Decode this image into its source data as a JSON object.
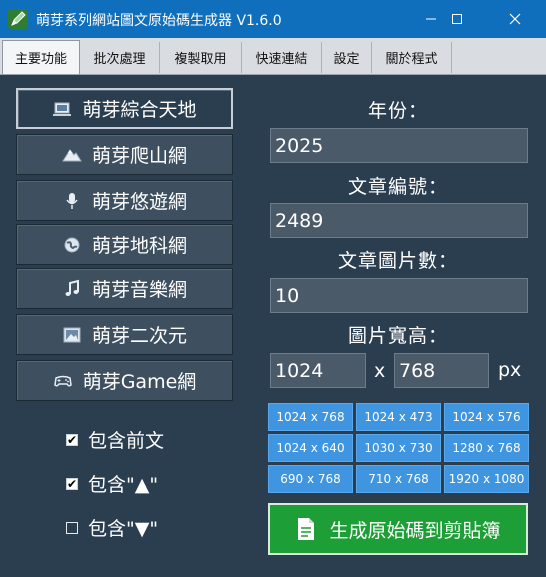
{
  "window": {
    "title": "萌芽系列網站圖文原始碼生成器 V1.6.0"
  },
  "tabs": [
    {
      "label": "主要功能",
      "active": true
    },
    {
      "label": "批次處理",
      "active": false
    },
    {
      "label": "複製取用",
      "active": false
    },
    {
      "label": "快速連結",
      "active": false
    },
    {
      "label": "設定",
      "active": false
    },
    {
      "label": "關於程式",
      "active": false
    }
  ],
  "sites": [
    {
      "label": "萌芽綜合天地",
      "icon": "laptop-icon",
      "active": true
    },
    {
      "label": "萌芽爬山網",
      "icon": "mountain-icon",
      "active": false
    },
    {
      "label": "萌芽悠遊網",
      "icon": "microphone-icon",
      "active": false
    },
    {
      "label": "萌芽地科網",
      "icon": "globe-icon",
      "active": false
    },
    {
      "label": "萌芽音樂網",
      "icon": "music-note-icon",
      "active": false
    },
    {
      "label": "萌芽二次元",
      "icon": "picture-frame-icon",
      "active": false
    },
    {
      "label": "萌芽Game網",
      "icon": "gamepad-icon",
      "active": false
    }
  ],
  "options": [
    {
      "label": "包含前文",
      "checked": true
    },
    {
      "label": "包含\"▲\"",
      "checked": true
    },
    {
      "label": "包含\"▼\"",
      "checked": false
    }
  ],
  "form": {
    "year_label": "年份：",
    "year_value": "2025",
    "article_label": "文章編號：",
    "article_value": "2489",
    "image_count_label": "文章圖片數：",
    "image_count_value": "10",
    "size_label": "圖片寬高：",
    "width_value": "1024",
    "times": "x",
    "height_value": "768",
    "unit": "px"
  },
  "presets": [
    "1024 x 768",
    "1024 x 473",
    "1024 x 576",
    "1024 x 640",
    "1030 x 730",
    "1280 x 768",
    "690 x 768",
    "710 x 768",
    "1920 x 1080"
  ],
  "generate_label": "生成原始碼到剪貼簿",
  "colors": {
    "titlebar": "#0f6fbd",
    "background": "#2b3e50",
    "preset": "#3f95e0",
    "generate": "#1e9e36"
  }
}
